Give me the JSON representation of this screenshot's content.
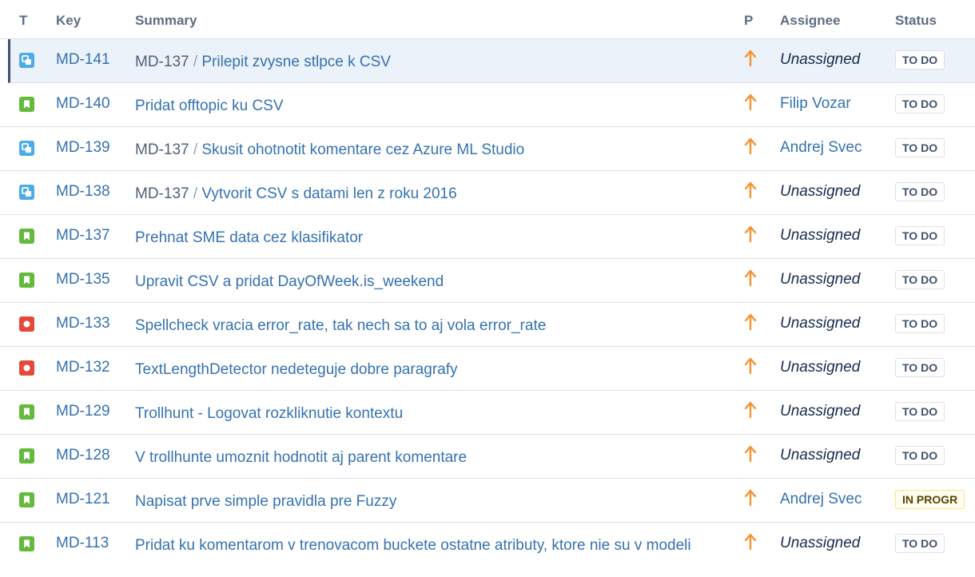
{
  "columns": {
    "type": "T",
    "key": "Key",
    "summary": "Summary",
    "priority": "P",
    "assignee": "Assignee",
    "status": "Status"
  },
  "colors": {
    "story": "#63ba3c",
    "subtask": "#4bade8",
    "bug": "#e5493a",
    "link": "#3572b0",
    "priority_major": "#f79232"
  },
  "issues": [
    {
      "type": "subtask-icon",
      "key": "MD-141",
      "parent": "MD-137",
      "sep": "/",
      "summary": "Prilepit zvysne stlpce k CSV",
      "priority": "arrow-up-icon",
      "assignee": "Unassigned",
      "status": "TO DO"
    },
    {
      "type": "story-icon",
      "key": "MD-140",
      "summary": "Pridat offtopic ku CSV",
      "priority": "arrow-up-icon",
      "assignee": "Filip Vozar",
      "status": "TO DO"
    },
    {
      "type": "subtask-icon",
      "key": "MD-139",
      "parent": "MD-137",
      "sep": "/",
      "summary": "Skusit ohotnotit komentare cez Azure ML Studio",
      "priority": "arrow-up-icon",
      "assignee": "Andrej Svec",
      "status": "TO DO"
    },
    {
      "type": "subtask-icon",
      "key": "MD-138",
      "parent": "MD-137",
      "sep": "/",
      "summary": "Vytvorit CSV s datami len z roku 2016",
      "priority": "arrow-up-icon",
      "assignee": "Unassigned",
      "status": "TO DO"
    },
    {
      "type": "story-icon",
      "key": "MD-137",
      "summary": "Prehnat SME data cez klasifikator",
      "priority": "arrow-up-icon",
      "assignee": "Unassigned",
      "status": "TO DO"
    },
    {
      "type": "story-icon",
      "key": "MD-135",
      "summary": "Upravit CSV a pridat DayOfWeek.is_weekend",
      "priority": "arrow-up-icon",
      "assignee": "Unassigned",
      "status": "TO DO"
    },
    {
      "type": "bug-icon",
      "key": "MD-133",
      "summary": "Spellcheck vracia error_rate, tak nech sa to aj vola error_rate",
      "priority": "arrow-up-icon",
      "assignee": "Unassigned",
      "status": "TO DO"
    },
    {
      "type": "bug-icon",
      "key": "MD-132",
      "summary": "TextLengthDetector nedeteguje dobre paragrafy",
      "priority": "arrow-up-icon",
      "assignee": "Unassigned",
      "status": "TO DO"
    },
    {
      "type": "story-icon",
      "key": "MD-129",
      "summary": "Trollhunt - Logovat rozkliknutie kontextu",
      "priority": "arrow-up-icon",
      "assignee": "Unassigned",
      "status": "TO DO"
    },
    {
      "type": "story-icon",
      "key": "MD-128",
      "summary": "V trollhunte umoznit hodnotit aj parent komentare",
      "priority": "arrow-up-icon",
      "assignee": "Unassigned",
      "status": "TO DO"
    },
    {
      "type": "story-icon",
      "key": "MD-121",
      "summary": "Napisat prve simple pravidla pre Fuzzy",
      "priority": "arrow-up-icon",
      "assignee": "Andrej Svec",
      "status": "IN PROGR"
    },
    {
      "type": "story-icon",
      "key": "MD-113",
      "summary": "Pridat ku komentarom v trenovacom buckete ostatne atributy, ktore nie su v modeli",
      "priority": "arrow-up-icon",
      "assignee": "Unassigned",
      "status": "TO DO"
    }
  ]
}
